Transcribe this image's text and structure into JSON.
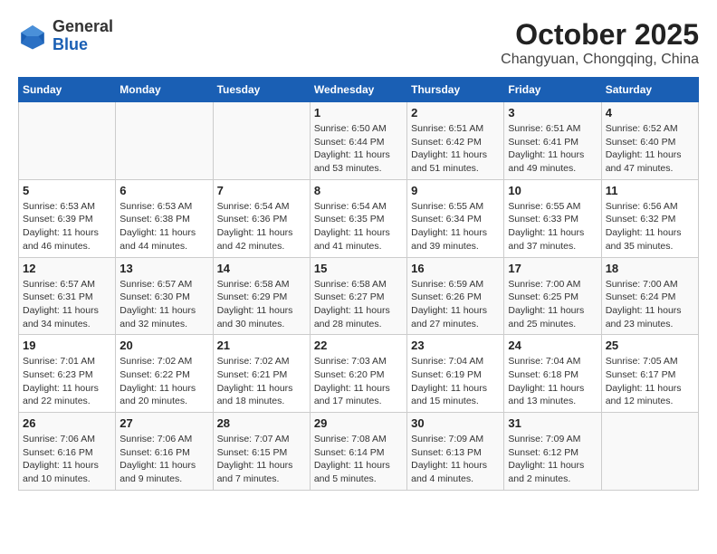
{
  "logo": {
    "general": "General",
    "blue": "Blue"
  },
  "title": "October 2025",
  "subtitle": "Changyuan, Chongqing, China",
  "weekdays": [
    "Sunday",
    "Monday",
    "Tuesday",
    "Wednesday",
    "Thursday",
    "Friday",
    "Saturday"
  ],
  "weeks": [
    [
      {
        "day": "",
        "sunrise": "",
        "sunset": "",
        "daylight": ""
      },
      {
        "day": "",
        "sunrise": "",
        "sunset": "",
        "daylight": ""
      },
      {
        "day": "",
        "sunrise": "",
        "sunset": "",
        "daylight": ""
      },
      {
        "day": "1",
        "sunrise": "Sunrise: 6:50 AM",
        "sunset": "Sunset: 6:44 PM",
        "daylight": "Daylight: 11 hours and 53 minutes."
      },
      {
        "day": "2",
        "sunrise": "Sunrise: 6:51 AM",
        "sunset": "Sunset: 6:42 PM",
        "daylight": "Daylight: 11 hours and 51 minutes."
      },
      {
        "day": "3",
        "sunrise": "Sunrise: 6:51 AM",
        "sunset": "Sunset: 6:41 PM",
        "daylight": "Daylight: 11 hours and 49 minutes."
      },
      {
        "day": "4",
        "sunrise": "Sunrise: 6:52 AM",
        "sunset": "Sunset: 6:40 PM",
        "daylight": "Daylight: 11 hours and 47 minutes."
      }
    ],
    [
      {
        "day": "5",
        "sunrise": "Sunrise: 6:53 AM",
        "sunset": "Sunset: 6:39 PM",
        "daylight": "Daylight: 11 hours and 46 minutes."
      },
      {
        "day": "6",
        "sunrise": "Sunrise: 6:53 AM",
        "sunset": "Sunset: 6:38 PM",
        "daylight": "Daylight: 11 hours and 44 minutes."
      },
      {
        "day": "7",
        "sunrise": "Sunrise: 6:54 AM",
        "sunset": "Sunset: 6:36 PM",
        "daylight": "Daylight: 11 hours and 42 minutes."
      },
      {
        "day": "8",
        "sunrise": "Sunrise: 6:54 AM",
        "sunset": "Sunset: 6:35 PM",
        "daylight": "Daylight: 11 hours and 41 minutes."
      },
      {
        "day": "9",
        "sunrise": "Sunrise: 6:55 AM",
        "sunset": "Sunset: 6:34 PM",
        "daylight": "Daylight: 11 hours and 39 minutes."
      },
      {
        "day": "10",
        "sunrise": "Sunrise: 6:55 AM",
        "sunset": "Sunset: 6:33 PM",
        "daylight": "Daylight: 11 hours and 37 minutes."
      },
      {
        "day": "11",
        "sunrise": "Sunrise: 6:56 AM",
        "sunset": "Sunset: 6:32 PM",
        "daylight": "Daylight: 11 hours and 35 minutes."
      }
    ],
    [
      {
        "day": "12",
        "sunrise": "Sunrise: 6:57 AM",
        "sunset": "Sunset: 6:31 PM",
        "daylight": "Daylight: 11 hours and 34 minutes."
      },
      {
        "day": "13",
        "sunrise": "Sunrise: 6:57 AM",
        "sunset": "Sunset: 6:30 PM",
        "daylight": "Daylight: 11 hours and 32 minutes."
      },
      {
        "day": "14",
        "sunrise": "Sunrise: 6:58 AM",
        "sunset": "Sunset: 6:29 PM",
        "daylight": "Daylight: 11 hours and 30 minutes."
      },
      {
        "day": "15",
        "sunrise": "Sunrise: 6:58 AM",
        "sunset": "Sunset: 6:27 PM",
        "daylight": "Daylight: 11 hours and 28 minutes."
      },
      {
        "day": "16",
        "sunrise": "Sunrise: 6:59 AM",
        "sunset": "Sunset: 6:26 PM",
        "daylight": "Daylight: 11 hours and 27 minutes."
      },
      {
        "day": "17",
        "sunrise": "Sunrise: 7:00 AM",
        "sunset": "Sunset: 6:25 PM",
        "daylight": "Daylight: 11 hours and 25 minutes."
      },
      {
        "day": "18",
        "sunrise": "Sunrise: 7:00 AM",
        "sunset": "Sunset: 6:24 PM",
        "daylight": "Daylight: 11 hours and 23 minutes."
      }
    ],
    [
      {
        "day": "19",
        "sunrise": "Sunrise: 7:01 AM",
        "sunset": "Sunset: 6:23 PM",
        "daylight": "Daylight: 11 hours and 22 minutes."
      },
      {
        "day": "20",
        "sunrise": "Sunrise: 7:02 AM",
        "sunset": "Sunset: 6:22 PM",
        "daylight": "Daylight: 11 hours and 20 minutes."
      },
      {
        "day": "21",
        "sunrise": "Sunrise: 7:02 AM",
        "sunset": "Sunset: 6:21 PM",
        "daylight": "Daylight: 11 hours and 18 minutes."
      },
      {
        "day": "22",
        "sunrise": "Sunrise: 7:03 AM",
        "sunset": "Sunset: 6:20 PM",
        "daylight": "Daylight: 11 hours and 17 minutes."
      },
      {
        "day": "23",
        "sunrise": "Sunrise: 7:04 AM",
        "sunset": "Sunset: 6:19 PM",
        "daylight": "Daylight: 11 hours and 15 minutes."
      },
      {
        "day": "24",
        "sunrise": "Sunrise: 7:04 AM",
        "sunset": "Sunset: 6:18 PM",
        "daylight": "Daylight: 11 hours and 13 minutes."
      },
      {
        "day": "25",
        "sunrise": "Sunrise: 7:05 AM",
        "sunset": "Sunset: 6:17 PM",
        "daylight": "Daylight: 11 hours and 12 minutes."
      }
    ],
    [
      {
        "day": "26",
        "sunrise": "Sunrise: 7:06 AM",
        "sunset": "Sunset: 6:16 PM",
        "daylight": "Daylight: 11 hours and 10 minutes."
      },
      {
        "day": "27",
        "sunrise": "Sunrise: 7:06 AM",
        "sunset": "Sunset: 6:16 PM",
        "daylight": "Daylight: 11 hours and 9 minutes."
      },
      {
        "day": "28",
        "sunrise": "Sunrise: 7:07 AM",
        "sunset": "Sunset: 6:15 PM",
        "daylight": "Daylight: 11 hours and 7 minutes."
      },
      {
        "day": "29",
        "sunrise": "Sunrise: 7:08 AM",
        "sunset": "Sunset: 6:14 PM",
        "daylight": "Daylight: 11 hours and 5 minutes."
      },
      {
        "day": "30",
        "sunrise": "Sunrise: 7:09 AM",
        "sunset": "Sunset: 6:13 PM",
        "daylight": "Daylight: 11 hours and 4 minutes."
      },
      {
        "day": "31",
        "sunrise": "Sunrise: 7:09 AM",
        "sunset": "Sunset: 6:12 PM",
        "daylight": "Daylight: 11 hours and 2 minutes."
      },
      {
        "day": "",
        "sunrise": "",
        "sunset": "",
        "daylight": ""
      }
    ]
  ]
}
